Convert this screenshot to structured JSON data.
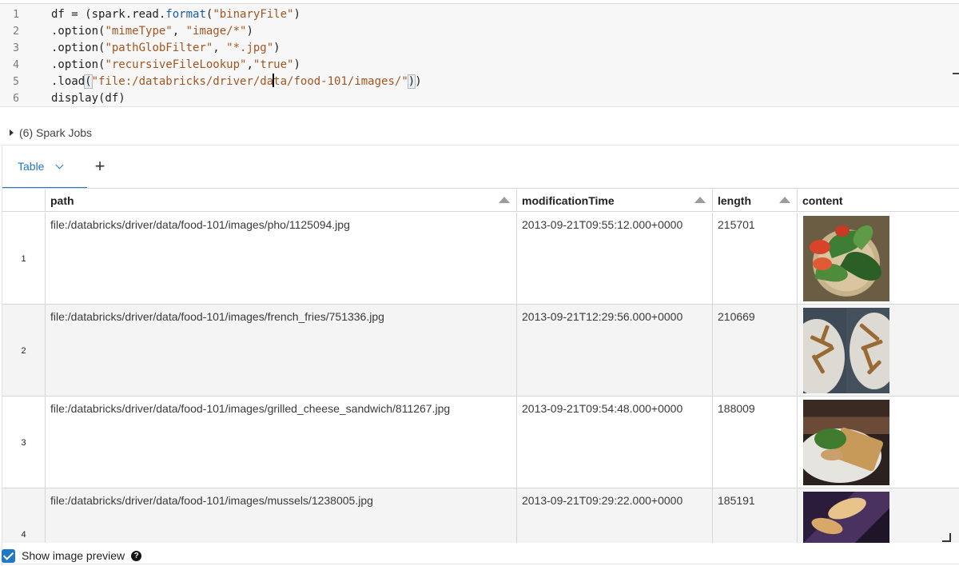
{
  "editor": {
    "lines": [
      {
        "n": "1",
        "parts": [
          [
            "",
            "df = (spark.read."
          ],
          [
            "fn",
            "format"
          ],
          [
            "",
            "("
          ],
          [
            "str",
            "\"binaryFile\""
          ],
          [
            "",
            ")"
          ]
        ]
      },
      {
        "n": "2",
        "parts": [
          [
            "",
            ".option("
          ],
          [
            "str",
            "\"mimeType\""
          ],
          [
            "",
            ", "
          ],
          [
            "str",
            "\"image/*\""
          ],
          [
            "",
            ")"
          ]
        ]
      },
      {
        "n": "3",
        "parts": [
          [
            "",
            ".option("
          ],
          [
            "str",
            "\"pathGlobFilter\""
          ],
          [
            "",
            ", "
          ],
          [
            "str",
            "\"*.jpg\""
          ],
          [
            "",
            ")"
          ]
        ]
      },
      {
        "n": "4",
        "parts": [
          [
            "",
            ".option("
          ],
          [
            "str",
            "\"recursiveFileLookup\""
          ],
          [
            "",
            ","
          ],
          [
            "str",
            "\"true\""
          ],
          [
            "",
            ")"
          ]
        ]
      },
      {
        "n": "5",
        "parts": [
          [
            "",
            ".load"
          ],
          [
            "hl",
            "("
          ],
          [
            "str",
            "\"file:/databricks/driver/da"
          ],
          [
            "cursor",
            ""
          ],
          [
            "str",
            "ta/food-101/images/\""
          ],
          [
            "hl",
            ")"
          ],
          [
            "",
            ")"
          ]
        ]
      },
      {
        "n": "6",
        "parts": [
          [
            "",
            "display(df)"
          ]
        ]
      }
    ]
  },
  "spark_jobs": {
    "label": "(6) Spark Jobs"
  },
  "tabs": {
    "active_label": "Table",
    "add_label": "+"
  },
  "table": {
    "columns": [
      "path",
      "modificationTime",
      "length",
      "content"
    ],
    "rows": [
      {
        "num": "1",
        "path": "file:/databricks/driver/data/food-101/images/pho/1125094.jpg",
        "modificationTime": "2013-09-21T09:55:12.000+0000",
        "length": "215701",
        "image": "pho"
      },
      {
        "num": "2",
        "path": "file:/databricks/driver/data/food-101/images/french_fries/751336.jpg",
        "modificationTime": "2013-09-21T12:29:56.000+0000",
        "length": "210669",
        "image": "french-fries"
      },
      {
        "num": "3",
        "path": "file:/databricks/driver/data/food-101/images/grilled_cheese_sandwich/811267.jpg",
        "modificationTime": "2013-09-21T09:54:48.000+0000",
        "length": "188009",
        "image": "grilled-cheese-sandwich"
      },
      {
        "num": "4",
        "path": "file:/databricks/driver/data/food-101/images/mussels/1238005.jpg",
        "modificationTime": "2013-09-21T09:29:22.000+0000",
        "length": "185191",
        "image": "mussels"
      }
    ]
  },
  "footer": {
    "checkbox_label": "Show image preview",
    "help_glyph": "?"
  },
  "colors": {
    "accent": "#1f78c8",
    "string": "#a3551f",
    "function": "#1f5aa8"
  }
}
